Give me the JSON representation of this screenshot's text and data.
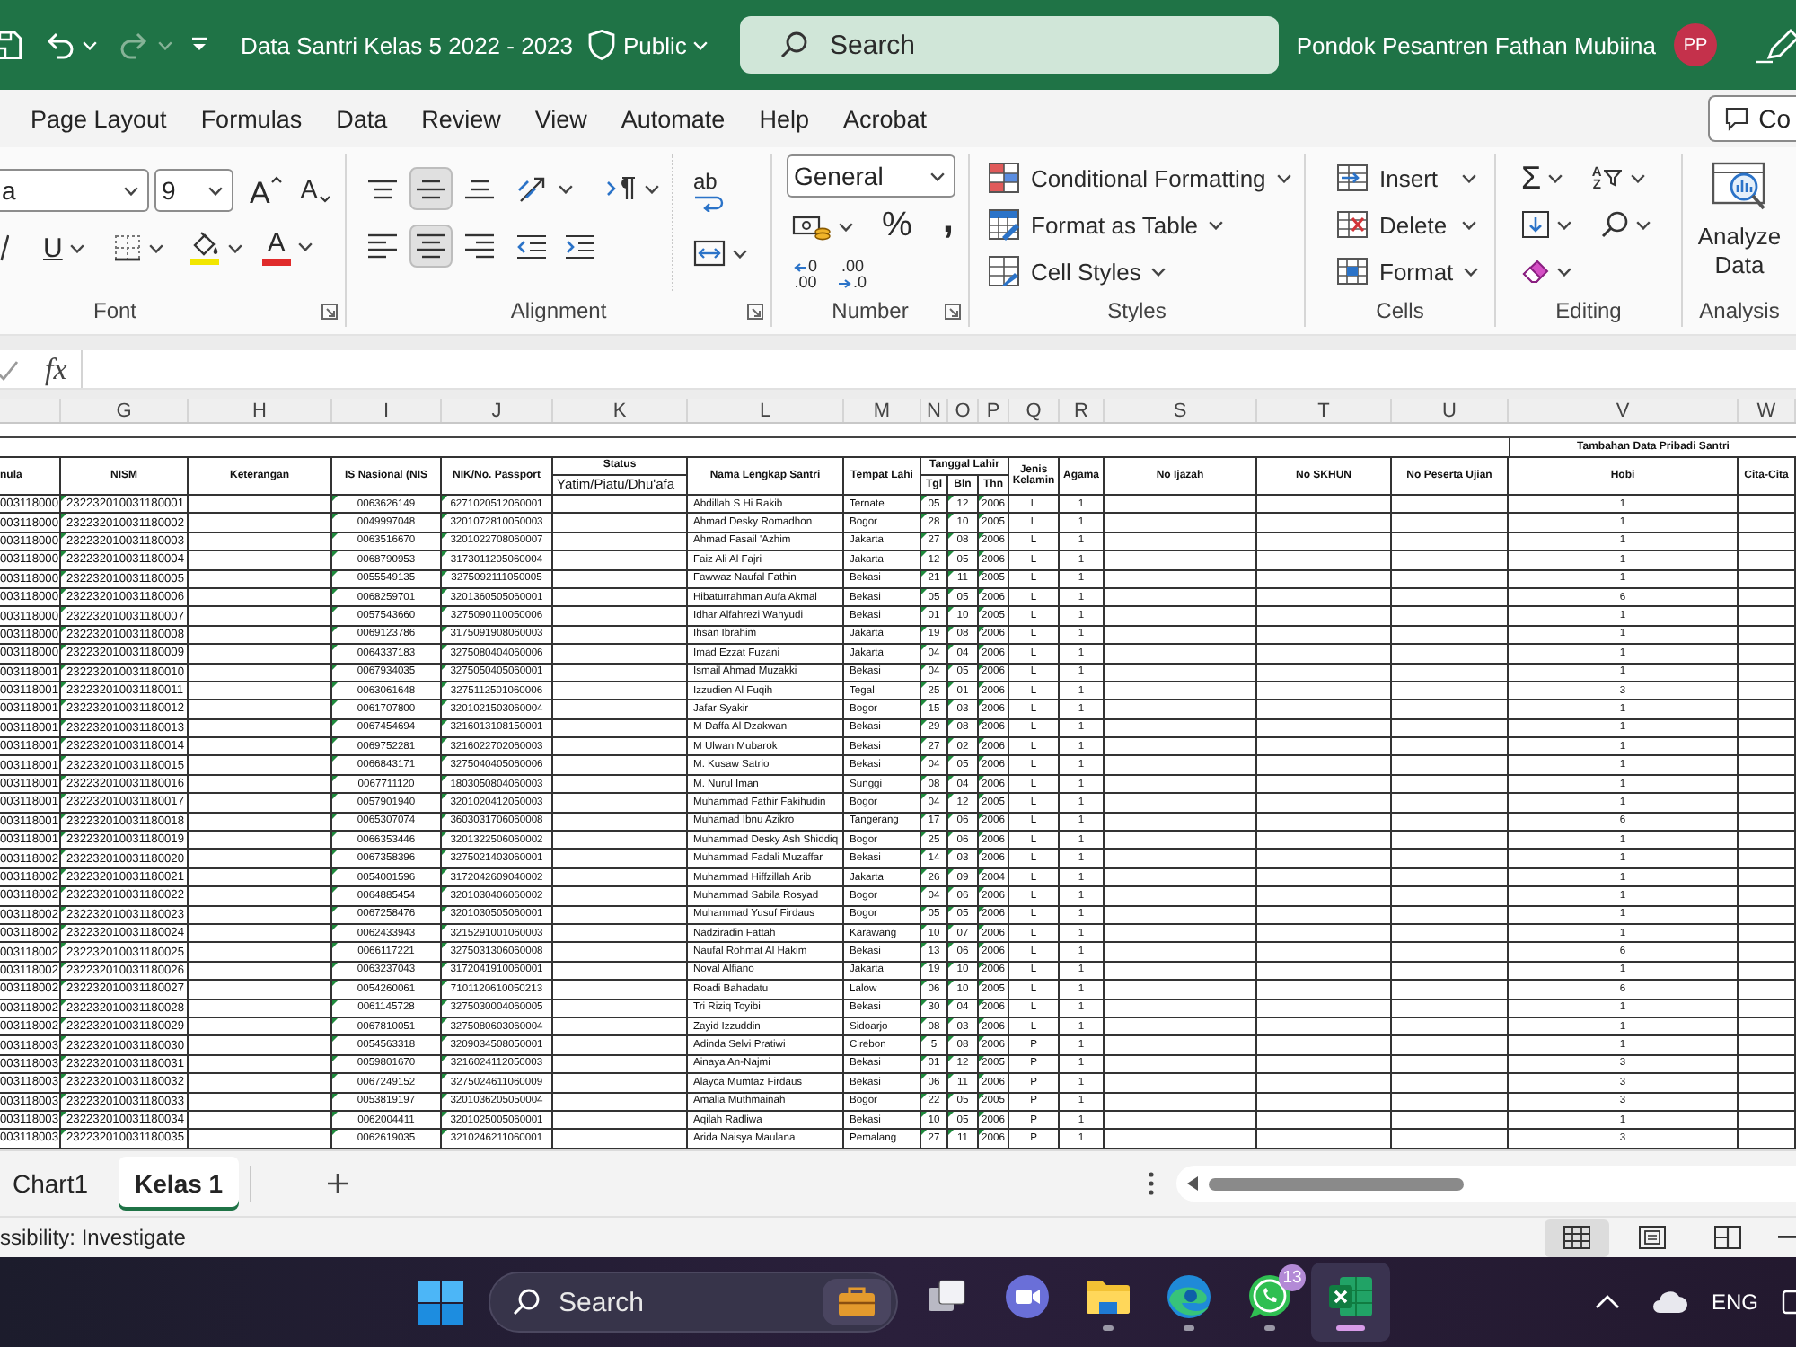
{
  "title_bar": {
    "quick_access": [
      {
        "kind": "save",
        "disabled": false
      },
      {
        "kind": "undo",
        "disabled": false
      },
      {
        "kind": "redo",
        "disabled": true
      }
    ],
    "document_title": "Data Santri Kelas 5 2022 - 2023",
    "sensitivity_label": "Public",
    "search": {
      "placeholder": "Search"
    },
    "account_name": "Pondok Pesantren Fathan Mubiina",
    "avatar_initials": "PP"
  },
  "menu_tabs": [
    {
      "label": "Page Layout",
      "selected": false
    },
    {
      "label": "Formulas",
      "selected": false
    },
    {
      "label": "Data",
      "selected": false
    },
    {
      "label": "Review",
      "selected": false
    },
    {
      "label": "View",
      "selected": false
    },
    {
      "label": "Automate",
      "selected": false
    },
    {
      "label": "Help",
      "selected": false
    },
    {
      "label": "Acrobat",
      "selected": false
    }
  ],
  "comments_button": {
    "label": "Co"
  },
  "ribbon": {
    "font": {
      "font_name": "a",
      "font_size": "9",
      "grow_font_glyph": "A",
      "shrink_font_glyph": "A",
      "underline_glyph": "U",
      "font_color_glyph": "A",
      "label": "Font"
    },
    "alignment": {
      "vertical": [
        {
          "kind": "top",
          "selected": false
        },
        {
          "kind": "middle",
          "selected": true
        },
        {
          "kind": "bottom",
          "selected": false
        }
      ],
      "horizontal": [
        {
          "kind": "left",
          "selected": false
        },
        {
          "kind": "center",
          "selected": true
        },
        {
          "kind": "right",
          "selected": false
        }
      ],
      "wrap_text": "ab",
      "label": "Alignment"
    },
    "number": {
      "format": "General",
      "percent": "%",
      "comma": ",",
      "increase_decimal": [
        "0",
        ".00"
      ],
      "decrease_decimal": [
        ".00",
        ".0"
      ],
      "label": "Number"
    },
    "styles": {
      "buttons": [
        {
          "kind": "conditional",
          "label": "Conditional Formatting"
        },
        {
          "kind": "table",
          "label": "Format as Table"
        },
        {
          "kind": "cell",
          "label": "Cell Styles"
        }
      ],
      "label": "Styles"
    },
    "cells": {
      "buttons": [
        {
          "kind": "insert",
          "label": "Insert"
        },
        {
          "kind": "delete",
          "label": "Delete"
        },
        {
          "kind": "format",
          "label": "Format"
        }
      ],
      "label": "Cells"
    },
    "editing": {
      "sum": "Σ",
      "sort": "AZ",
      "label": "Editing"
    },
    "analysis": {
      "button": "Analyze Data",
      "label": "Analysis"
    }
  },
  "formula_bar": {
    "function_label": "fx"
  },
  "sheet": {
    "section_title": "Tambahan Data Pribadi Santri",
    "birth_date_group": "Tanggal Lahir",
    "columns": [
      {
        "header": "nula",
        "error_flag": false
      },
      {
        "letter": "G",
        "header": "NISM",
        "error_flag": true
      },
      {
        "letter": "H",
        "header": "Keterangan",
        "error_flag": false
      },
      {
        "letter": "I",
        "header": "IS Nasional (NIS",
        "error_flag": true
      },
      {
        "letter": "J",
        "header": "NIK/No. Passport",
        "error_flag": true
      },
      {
        "letter": "K",
        "header": "Status",
        "subheader": "Yatim/Piatu/Dhu'afa",
        "error_flag": false
      },
      {
        "letter": "L",
        "header": "Nama Lengkap Santri",
        "error_flag": false
      },
      {
        "letter": "M",
        "header": "Tempat Lahi",
        "error_flag": false
      },
      {
        "letter": "N",
        "subheader": "Tgl",
        "error_flag": true
      },
      {
        "letter": "O",
        "subheader": "Bln",
        "error_flag": true
      },
      {
        "letter": "P",
        "subheader": "Thn",
        "error_flag": true
      },
      {
        "letter": "Q",
        "header": "Jenis Kelamin",
        "error_flag": false
      },
      {
        "letter": "R",
        "header": "Agama",
        "error_flag": false
      },
      {
        "letter": "S",
        "header": "No Ijazah",
        "error_flag": false
      },
      {
        "letter": "T",
        "header": "No SKHUN",
        "error_flag": false
      },
      {
        "letter": "U",
        "header": "No Peserta Ujian",
        "error_flag": false
      },
      {
        "letter": "V",
        "header": "Hobi",
        "error_flag": false
      },
      {
        "letter": "W",
        "header": "Cita-Cita",
        "error_flag": false
      }
    ],
    "rows": [
      {
        "column_f": "003118000",
        "nism": "232232010031180001",
        "nisn": "0063626149",
        "nik": "6271020512060001",
        "nama": "Abdillah S Hi Rakib",
        "tempat_lahir": "Ternate",
        "tgl": "05",
        "bln": "12",
        "thn": "2006",
        "jenis_kelamin": "L",
        "agama": "1",
        "hobi": "1"
      },
      {
        "column_f": "003118000",
        "nism": "232232010031180002",
        "nisn": "0049997048",
        "nik": "3201072810050003",
        "nama": "Ahmad Desky Romadhon",
        "tempat_lahir": "Bogor",
        "tgl": "28",
        "bln": "10",
        "thn": "2005",
        "jenis_kelamin": "L",
        "agama": "1",
        "hobi": "1"
      },
      {
        "column_f": "003118000",
        "nism": "232232010031180003",
        "nisn": "0063516670",
        "nik": "3201022708060007",
        "nama": "Ahmad Fasail 'Azhim",
        "tempat_lahir": "Jakarta",
        "tgl": "27",
        "bln": "08",
        "thn": "2006",
        "jenis_kelamin": "L",
        "agama": "1",
        "hobi": "1"
      },
      {
        "column_f": "003118000",
        "nism": "232232010031180004",
        "nisn": "0068790953",
        "nik": "3173011205060004",
        "nama": "Faiz Ali Al Fajri",
        "tempat_lahir": "Jakarta",
        "tgl": "12",
        "bln": "05",
        "thn": "2006",
        "jenis_kelamin": "L",
        "agama": "1",
        "hobi": "1"
      },
      {
        "column_f": "003118000",
        "nism": "232232010031180005",
        "nisn": "0055549135",
        "nik": "3275092111050005",
        "nama": "Fawwaz Naufal Fathin",
        "tempat_lahir": "Bekasi",
        "tgl": "21",
        "bln": "11",
        "thn": "2005",
        "jenis_kelamin": "L",
        "agama": "1",
        "hobi": "1"
      },
      {
        "column_f": "003118000",
        "nism": "232232010031180006",
        "nisn": "0068259701",
        "nik": "3201360505060001",
        "nama": "Hibaturrahman Aufa Akmal",
        "tempat_lahir": "Bekasi",
        "tgl": "05",
        "bln": "05",
        "thn": "2006",
        "jenis_kelamin": "L",
        "agama": "1",
        "hobi": "6"
      },
      {
        "column_f": "003118000",
        "nism": "232232010031180007",
        "nisn": "0057543660",
        "nik": "3275090110050006",
        "nama": "Idhar Alfahrezi Wahyudi",
        "tempat_lahir": "Bekasi",
        "tgl": "01",
        "bln": "10",
        "thn": "2005",
        "jenis_kelamin": "L",
        "agama": "1",
        "hobi": "1"
      },
      {
        "column_f": "003118000",
        "nism": "232232010031180008",
        "nisn": "0069123786",
        "nik": "3175091908060003",
        "nama": "Ihsan Ibrahim",
        "tempat_lahir": "Jakarta",
        "tgl": "19",
        "bln": "08",
        "thn": "2006",
        "jenis_kelamin": "L",
        "agama": "1",
        "hobi": "1"
      },
      {
        "column_f": "003118000",
        "nism": "232232010031180009",
        "nisn": "0064337183",
        "nik": "3275080404060006",
        "nama": "Imad Ezzat Fuzani",
        "tempat_lahir": "Jakarta",
        "tgl": "04",
        "bln": "04",
        "thn": "2006",
        "jenis_kelamin": "L",
        "agama": "1",
        "hobi": "1"
      },
      {
        "column_f": "003118001",
        "nism": "232232010031180010",
        "nisn": "0067934035",
        "nik": "3275050405060001",
        "nama": "Ismail Ahmad Muzakki",
        "tempat_lahir": "Bekasi",
        "tgl": "04",
        "bln": "05",
        "thn": "2006",
        "jenis_kelamin": "L",
        "agama": "1",
        "hobi": "1"
      },
      {
        "column_f": "003118001",
        "nism": "232232010031180011",
        "nisn": "0063061648",
        "nik": "3275112501060006",
        "nama": "Izzudien Al Fuqih",
        "tempat_lahir": "Tegal",
        "tgl": "25",
        "bln": "01",
        "thn": "2006",
        "jenis_kelamin": "L",
        "agama": "1",
        "hobi": "3"
      },
      {
        "column_f": "003118001",
        "nism": "232232010031180012",
        "nisn": "0061707800",
        "nik": "3201021503060004",
        "nama": "Jafar Syakir",
        "tempat_lahir": "Bogor",
        "tgl": "15",
        "bln": "03",
        "thn": "2006",
        "jenis_kelamin": "L",
        "agama": "1",
        "hobi": "1"
      },
      {
        "column_f": "003118001",
        "nism": "232232010031180013",
        "nisn": "0067454694",
        "nik": "3216013108150001",
        "nama": "M Daffa Al Dzakwan",
        "tempat_lahir": "Bekasi",
        "tgl": "29",
        "bln": "08",
        "thn": "2006",
        "jenis_kelamin": "L",
        "agama": "1",
        "hobi": "1"
      },
      {
        "column_f": "003118001",
        "nism": "232232010031180014",
        "nisn": "0069752281",
        "nik": "3216022702060003",
        "nama": "M Ulwan Mubarok",
        "tempat_lahir": "Bekasi",
        "tgl": "27",
        "bln": "02",
        "thn": "2006",
        "jenis_kelamin": "L",
        "agama": "1",
        "hobi": "1"
      },
      {
        "column_f": "003118001",
        "nism": "232232010031180015",
        "nisn": "0066843171",
        "nik": "3275040405060006",
        "nama": "M. Kusaw Satrio",
        "tempat_lahir": "Bekasi",
        "tgl": "04",
        "bln": "05",
        "thn": "2006",
        "jenis_kelamin": "L",
        "agama": "1",
        "hobi": "1"
      },
      {
        "column_f": "003118001",
        "nism": "232232010031180016",
        "nisn": "0067711120",
        "nik": "1803050804060003",
        "nama": "M. Nurul Iman",
        "tempat_lahir": "Sunggi",
        "tgl": "08",
        "bln": "04",
        "thn": "2006",
        "jenis_kelamin": "L",
        "agama": "1",
        "hobi": "1"
      },
      {
        "column_f": "003118001",
        "nism": "232232010031180017",
        "nisn": "0057901940",
        "nik": "3201020412050003",
        "nama": "Muhammad Fathir Fakihudin",
        "tempat_lahir": "Bogor",
        "tgl": "04",
        "bln": "12",
        "thn": "2005",
        "jenis_kelamin": "L",
        "agama": "1",
        "hobi": "1"
      },
      {
        "column_f": "003118001",
        "nism": "232232010031180018",
        "nisn": "0065307074",
        "nik": "3603031706060008",
        "nama": "Muhamad Ibnu Azikro",
        "tempat_lahir": "Tangerang",
        "tgl": "17",
        "bln": "06",
        "thn": "2006",
        "jenis_kelamin": "L",
        "agama": "1",
        "hobi": "6"
      },
      {
        "column_f": "003118001",
        "nism": "232232010031180019",
        "nisn": "0066353446",
        "nik": "3201322506060002",
        "nama": "Muhammad Desky Ash Shiddiq",
        "tempat_lahir": "Bogor",
        "tgl": "25",
        "bln": "06",
        "thn": "2006",
        "jenis_kelamin": "L",
        "agama": "1",
        "hobi": "1"
      },
      {
        "column_f": "003118002",
        "nism": "232232010031180020",
        "nisn": "0067358396",
        "nik": "3275021403060001",
        "nama": "Muhammad Fadali Muzaffar",
        "tempat_lahir": "Bekasi",
        "tgl": "14",
        "bln": "03",
        "thn": "2006",
        "jenis_kelamin": "L",
        "agama": "1",
        "hobi": "1"
      },
      {
        "column_f": "003118002",
        "nism": "232232010031180021",
        "nisn": "0054001596",
        "nik": "3172042609040002",
        "nama": "Muhammad Hiffzillah Arib",
        "tempat_lahir": "Jakarta",
        "tgl": "26",
        "bln": "09",
        "thn": "2004",
        "jenis_kelamin": "L",
        "agama": "1",
        "hobi": "1"
      },
      {
        "column_f": "003118002",
        "nism": "232232010031180022",
        "nisn": "0064885454",
        "nik": "3201030406060002",
        "nama": "Muhammad Sabila Rosyad",
        "tempat_lahir": "Bogor",
        "tgl": "04",
        "bln": "06",
        "thn": "2006",
        "jenis_kelamin": "L",
        "agama": "1",
        "hobi": "1"
      },
      {
        "column_f": "003118002",
        "nism": "232232010031180023",
        "nisn": "0067258476",
        "nik": "3201030505060001",
        "nama": "Muhammad Yusuf Firdaus",
        "tempat_lahir": "Bogor",
        "tgl": "05",
        "bln": "05",
        "thn": "2006",
        "jenis_kelamin": "L",
        "agama": "1",
        "hobi": "1"
      },
      {
        "column_f": "003118002",
        "nism": "232232010031180024",
        "nisn": "0062433943",
        "nik": "3215291001060003",
        "nama": "Nadziradin Fattah",
        "tempat_lahir": "Karawang",
        "tgl": "10",
        "bln": "07",
        "thn": "2006",
        "jenis_kelamin": "L",
        "agama": "1",
        "hobi": "1"
      },
      {
        "column_f": "003118002",
        "nism": "232232010031180025",
        "nisn": "0066117221",
        "nik": "3275031306060008",
        "nama": "Naufal Rohmat Al Hakim",
        "tempat_lahir": "Bekasi",
        "tgl": "13",
        "bln": "06",
        "thn": "2006",
        "jenis_kelamin": "L",
        "agama": "1",
        "hobi": "6"
      },
      {
        "column_f": "003118002",
        "nism": "232232010031180026",
        "nisn": "0063237043",
        "nik": "3172041910060001",
        "nama": "Noval Alfiano",
        "tempat_lahir": "Jakarta",
        "tgl": "19",
        "bln": "10",
        "thn": "2006",
        "jenis_kelamin": "L",
        "agama": "1",
        "hobi": "1"
      },
      {
        "column_f": "003118002",
        "nism": "232232010031180027",
        "nisn": "0054260061",
        "nik": "7101120610050213",
        "nama": "Roadi Bahadatu",
        "tempat_lahir": "Lalow",
        "tgl": "06",
        "bln": "10",
        "thn": "2005",
        "jenis_kelamin": "L",
        "agama": "1",
        "hobi": "6"
      },
      {
        "column_f": "003118002",
        "nism": "232232010031180028",
        "nisn": "0061145728",
        "nik": "3275030004060005",
        "nama": "Tri Riziq Toyibi",
        "tempat_lahir": "Bekasi",
        "tgl": "30",
        "bln": "04",
        "thn": "2006",
        "jenis_kelamin": "L",
        "agama": "1",
        "hobi": "1"
      },
      {
        "column_f": "003118002",
        "nism": "232232010031180029",
        "nisn": "0067810051",
        "nik": "3275080603060004",
        "nama": "Zayid Izzuddin",
        "tempat_lahir": "Sidoarjo",
        "tgl": "08",
        "bln": "03",
        "thn": "2006",
        "jenis_kelamin": "L",
        "agama": "1",
        "hobi": "1"
      },
      {
        "column_f": "003118003",
        "nism": "232232010031180030",
        "nisn": "0054563318",
        "nik": "3209034508050001",
        "nama": "Adinda Selvi Pratiwi",
        "tempat_lahir": "Cirebon",
        "tgl": "5",
        "bln": "08",
        "thn": "2006",
        "jenis_kelamin": "P",
        "agama": "1",
        "hobi": "1"
      },
      {
        "column_f": "003118003",
        "nism": "232232010031180031",
        "nisn": "0059801670",
        "nik": "3216024112050003",
        "nama": "Ainaya An-Najmi",
        "tempat_lahir": "Bekasi",
        "tgl": "01",
        "bln": "12",
        "thn": "2005",
        "jenis_kelamin": "P",
        "agama": "1",
        "hobi": "3"
      },
      {
        "column_f": "003118003",
        "nism": "232232010031180032",
        "nisn": "0067249152",
        "nik": "3275024611060009",
        "nama": "Alayca Mumtaz Firdaus",
        "tempat_lahir": "Bekasi",
        "tgl": "06",
        "bln": "11",
        "thn": "2006",
        "jenis_kelamin": "P",
        "agama": "1",
        "hobi": "3"
      },
      {
        "column_f": "003118003",
        "nism": "232232010031180033",
        "nisn": "0053819197",
        "nik": "3201036205050004",
        "nama": "Amalia Muthmainah",
        "tempat_lahir": "Bogor",
        "tgl": "22",
        "bln": "05",
        "thn": "2005",
        "jenis_kelamin": "P",
        "agama": "1",
        "hobi": "3"
      },
      {
        "column_f": "003118003",
        "nism": "232232010031180034",
        "nisn": "0062004411",
        "nik": "3201025005060001",
        "nama": "Aqilah Radliwa",
        "tempat_lahir": "Bekasi",
        "tgl": "10",
        "bln": "05",
        "thn": "2006",
        "jenis_kelamin": "P",
        "agama": "1",
        "hobi": "1"
      },
      {
        "column_f": "003118003",
        "nism": "232232010031180035",
        "nisn": "0062619035",
        "nik": "3210246211060001",
        "nama": "Arida Naisya Maulana",
        "tempat_lahir": "Pemalang",
        "tgl": "27",
        "bln": "11",
        "thn": "2006",
        "jenis_kelamin": "P",
        "agama": "1",
        "hobi": "3"
      }
    ]
  },
  "sheet_tabs": [
    {
      "label": "Chart1",
      "selected": false
    },
    {
      "label": "Kelas 1",
      "selected": true
    }
  ],
  "status_bar": {
    "accessibility": "ssibility: Investigate",
    "views": [
      {
        "kind": "normal",
        "selected": true
      },
      {
        "kind": "page-layout",
        "selected": false
      },
      {
        "kind": "page-break",
        "selected": false
      }
    ]
  },
  "taskbar": {
    "search": {
      "placeholder": "Search"
    },
    "apps": [
      {
        "kind": "task-view",
        "running": false,
        "selected": false
      },
      {
        "kind": "video-call",
        "running": false,
        "selected": false
      },
      {
        "kind": "folder",
        "running": true,
        "selected": false
      },
      {
        "kind": "browser",
        "running": true,
        "selected": false
      },
      {
        "kind": "chat",
        "running": true,
        "selected": false,
        "badge": "13"
      },
      {
        "kind": "spreadsheet",
        "running": true,
        "selected": true
      }
    ],
    "language": "ENG"
  }
}
